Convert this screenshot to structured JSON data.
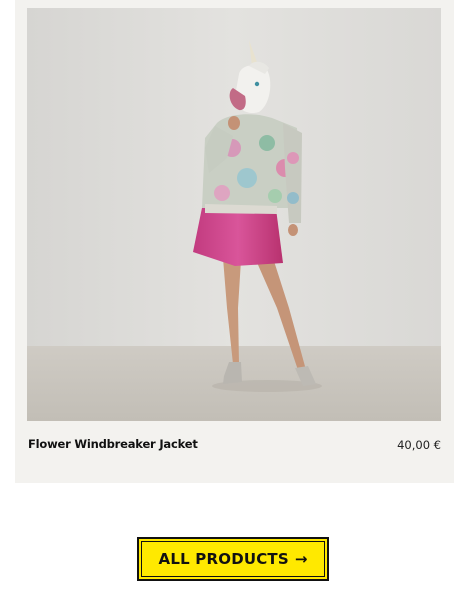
{
  "product": {
    "name": "Flower Windbreaker Jacket",
    "price": "40,00 €",
    "image_icon": "product-photo"
  },
  "cta": {
    "label": "ALL PRODUCTS",
    "arrow": "→",
    "background": "#ffe900",
    "border": "#111111"
  },
  "colors": {
    "card_background": "#f3f2ef",
    "page_background": "#ffffff"
  }
}
